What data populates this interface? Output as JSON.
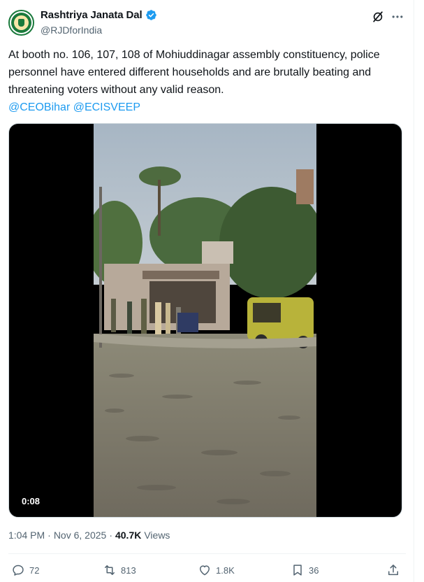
{
  "author": {
    "display_name": "Rashtriya Janata Dal",
    "handle": "@RJDforIndia",
    "verified": true
  },
  "icons": {
    "avatar": "rjd-logo",
    "verified": "verified-badge-icon",
    "grok": "grok-icon",
    "more": "more-icon",
    "reply": "reply-icon",
    "repost": "repost-icon",
    "like": "like-icon",
    "bookmark": "bookmark-icon",
    "share": "share-icon"
  },
  "tweet": {
    "text": "At booth no. 106, 107, 108 of Mohiuddinagar assembly constituency, police personnel have entered different households and are brutally beating and threatening voters without any valid reason.",
    "mentions": "@CEOBihar @ECISVEEP"
  },
  "media": {
    "type": "video",
    "duration": "0:08"
  },
  "meta": {
    "time": "1:04 PM",
    "separator": "·",
    "date": "Nov 6, 2025",
    "views_count": "40.7K",
    "views_label": "Views"
  },
  "actions": {
    "replies": "72",
    "reposts": "813",
    "likes": "1.8K",
    "bookmarks": "36"
  },
  "colors": {
    "accent": "#1d9bf0",
    "text": "#0f1419",
    "muted": "#536471",
    "party_green": "#1a7a3c"
  }
}
